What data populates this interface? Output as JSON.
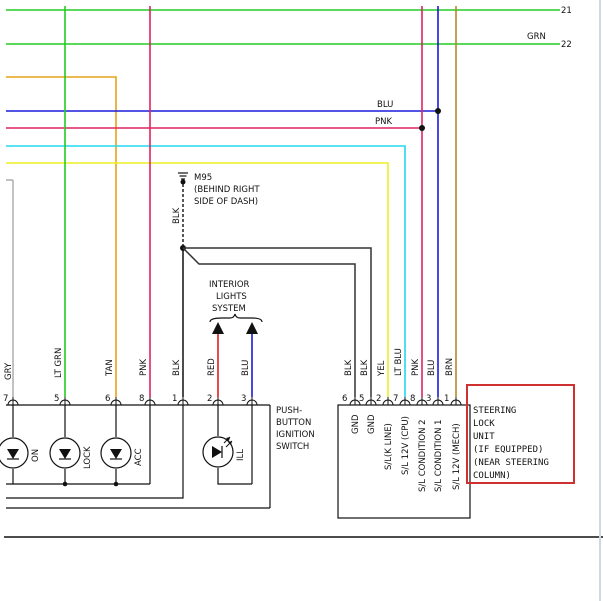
{
  "wires_top": {
    "w21": "21",
    "w22_color": "GRN",
    "w22": "22",
    "blu": "BLU",
    "pnk": "PNK"
  },
  "ground": {
    "id": "M95",
    "loc1": "(BEHIND RIGHT",
    "loc2": "SIDE OF DASH)",
    "wire": "BLK"
  },
  "interior": {
    "line1": "INTERIOR",
    "line2": "LIGHTS",
    "line3": "SYSTEM"
  },
  "switch_wires": [
    {
      "color": "GRY",
      "pin": "7"
    },
    {
      "color": "LT GRN",
      "pin": "5"
    },
    {
      "color": "TAN",
      "pin": "6"
    },
    {
      "color": "PNK",
      "pin": "8"
    },
    {
      "color": "BLK",
      "pin": "1"
    },
    {
      "color": "RED",
      "pin": "2"
    },
    {
      "color": "BLU",
      "pin": "3"
    }
  ],
  "switch": {
    "led_on": "ON",
    "led_lock": "LOCK",
    "led_acc": "ACC",
    "led_ill": "ILL",
    "name1": "PUSH-",
    "name2": "BUTTON",
    "name3": "IGNITION",
    "name4": "SWITCH"
  },
  "lock_wires": [
    {
      "color": "BLK",
      "pin": "6",
      "func": "GND"
    },
    {
      "color": "BLK",
      "pin": "5",
      "func": "GND"
    },
    {
      "color": "YEL",
      "pin": "2",
      "func": "S/L(K LINE)"
    },
    {
      "color": "LT BLU",
      "pin": "7",
      "func": "S/L 12V (CPU)"
    },
    {
      "color": "PNK",
      "pin": "8",
      "func": "S/L CONDITION 2"
    },
    {
      "color": "BLU",
      "pin": "3",
      "func": "S/L CONDITION 1"
    },
    {
      "color": "BRN",
      "pin": "1",
      "func": "S/L 12V (MECH)"
    }
  ],
  "steering": {
    "line1": "STEERING",
    "line2": "LOCK",
    "line3": "UNIT",
    "line4": "(IF EQUIPPED)",
    "line5": "(NEAR STEERING",
    "line6": "COLUMN)"
  },
  "colors": {
    "green": "#22cc22",
    "pink": "#e0245e",
    "orange": "#e6a21a",
    "blue": "#1a1adc",
    "cyan": "#22d8ee",
    "yellow": "#eeee22",
    "brown": "#b8862a",
    "gray": "#a8a8a8",
    "black": "#222222",
    "red": "#e02020",
    "highlight": "#d03030"
  }
}
